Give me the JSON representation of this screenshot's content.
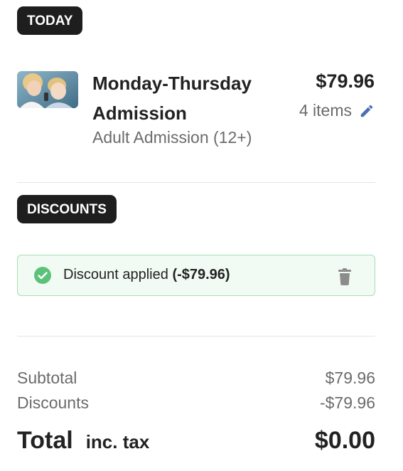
{
  "sections": {
    "today_label": "TODAY",
    "discounts_label": "DISCOUNTS"
  },
  "product": {
    "name": "Monday-Thursday Admission",
    "ticket_type": "Adult Admission (12+)",
    "price": "$79.96",
    "quantity_text": "4 items",
    "edit_icon": "pencil-icon",
    "image_icon": "product-photo"
  },
  "discount": {
    "status_text": "Discount applied",
    "amount": "(-$79.96)",
    "status_icon": "check-circle-icon",
    "remove_icon": "trash-icon",
    "colors": {
      "border": "#a9dcb3",
      "background": "#f2fbf3",
      "check": "#5cc27a"
    }
  },
  "summary": {
    "subtotal_label": "Subtotal",
    "subtotal_value": "$79.96",
    "discounts_label": "Discounts",
    "discounts_value": "-$79.96",
    "total_label": "Total",
    "total_tax_note": "inc. tax",
    "total_value": "$0.00"
  },
  "colors": {
    "pill_bg": "#1e1e1e",
    "accent": "#4a6fb5",
    "muted_text": "#6b6b6b"
  }
}
